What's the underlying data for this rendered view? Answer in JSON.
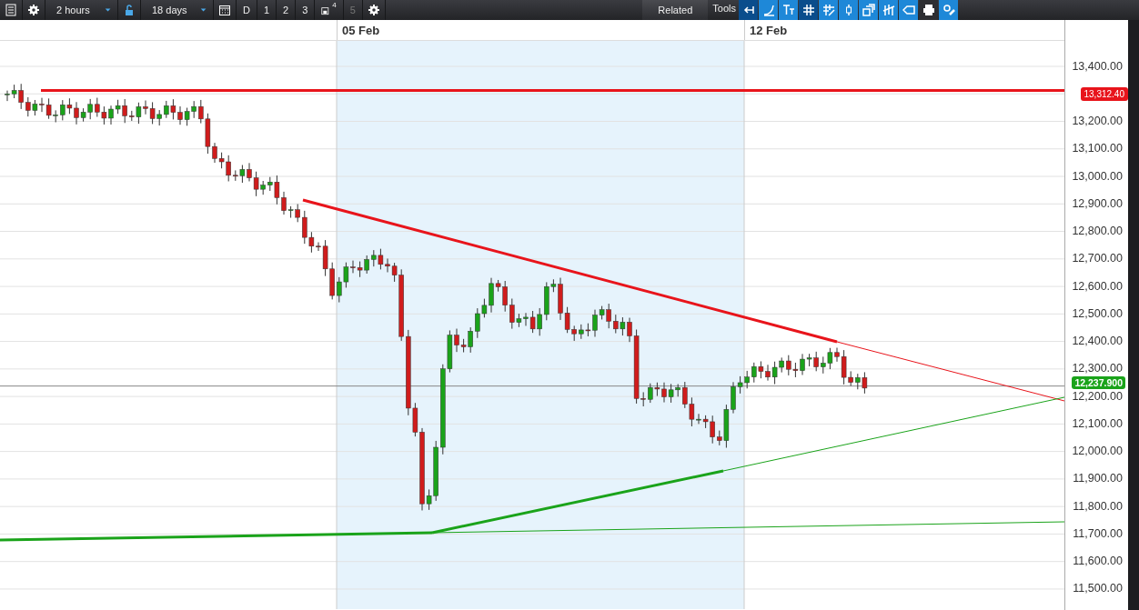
{
  "toolbar": {
    "interval": {
      "value": "2 hours"
    },
    "range": {
      "value": "18 days"
    },
    "presets": [
      {
        "label": "D",
        "kind": "plain",
        "disabled": false
      },
      {
        "label": "1",
        "kind": "plain",
        "disabled": false
      },
      {
        "label": "2",
        "kind": "plain",
        "disabled": false
      },
      {
        "label": "3",
        "kind": "plain",
        "disabled": false
      },
      {
        "label": "4",
        "kind": "saved",
        "disabled": false
      },
      {
        "label": "5",
        "kind": "plain",
        "disabled": true
      }
    ],
    "related_button": "Related",
    "tools_label": "Tools",
    "tools": [
      {
        "kind": "back",
        "selected": true
      },
      {
        "kind": "curve",
        "selected": false
      },
      {
        "kind": "text",
        "selected": false
      },
      {
        "kind": "grid",
        "selected": true
      },
      {
        "kind": "pen-grid",
        "selected": false
      },
      {
        "kind": "candle",
        "selected": false
      },
      {
        "kind": "windows",
        "selected": false
      },
      {
        "kind": "bars",
        "selected": false
      },
      {
        "kind": "tag",
        "selected": false
      },
      {
        "kind": "print",
        "selected": false
      },
      {
        "kind": "settings",
        "selected": false
      }
    ]
  },
  "chart": {
    "date_labels": [
      "05 Feb",
      "12 Feb"
    ],
    "y_axis": [
      {
        "kind": "tick",
        "label": "13,400.00"
      },
      {
        "kind": "badge",
        "label": "13,312.40",
        "color": "#e8141b"
      },
      {
        "kind": "tick",
        "label": "13,200.00"
      },
      {
        "kind": "tick",
        "label": "13,100.00"
      },
      {
        "kind": "tick",
        "label": "13,000.00"
      },
      {
        "kind": "tick",
        "label": "12,900.00"
      },
      {
        "kind": "tick",
        "label": "12,800.00"
      },
      {
        "kind": "tick",
        "label": "12,700.00"
      },
      {
        "kind": "tick",
        "label": "12,600.00"
      },
      {
        "kind": "tick",
        "label": "12,500.00"
      },
      {
        "kind": "tick",
        "label": "12,400.00"
      },
      {
        "kind": "tick",
        "label": "12,300.00"
      },
      {
        "kind": "tick",
        "label": "12,200.00"
      },
      {
        "kind": "tick",
        "label": "12,100.00"
      },
      {
        "kind": "tick",
        "label": "12,000.00"
      },
      {
        "kind": "tick",
        "label": "11,900.00"
      },
      {
        "kind": "tick",
        "label": "11,800.00"
      },
      {
        "kind": "tick",
        "label": "11,700.00"
      },
      {
        "kind": "tick",
        "label": "11,600.00"
      },
      {
        "kind": "tick",
        "label": "11,500.00"
      }
    ],
    "last_price": {
      "label": "12,237.900",
      "color": "#1aa31a"
    }
  }
}
